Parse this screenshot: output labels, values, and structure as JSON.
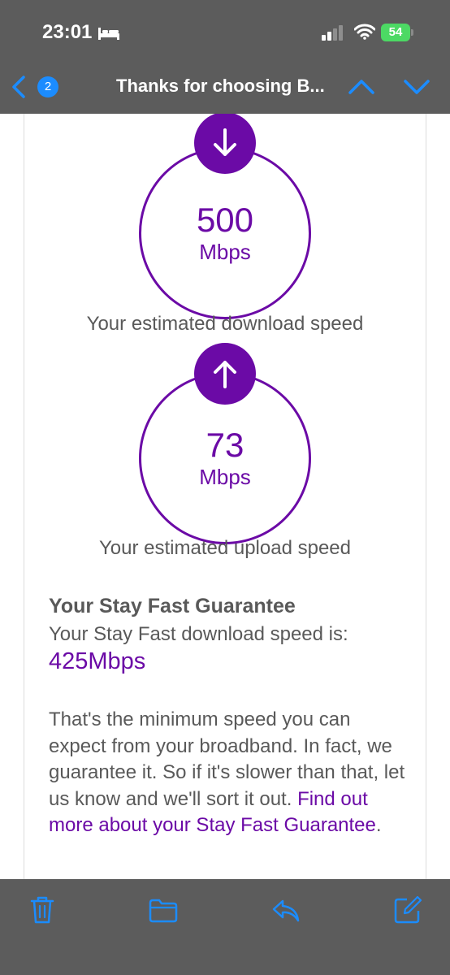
{
  "status_bar": {
    "time": "23:01",
    "battery": "54"
  },
  "nav": {
    "unread_count": "2",
    "title": "Thanks for choosing B..."
  },
  "download": {
    "value": "500",
    "unit": "Mbps",
    "caption": "Your estimated download speed",
    "icon": "arrow-down-icon"
  },
  "upload": {
    "value": "73",
    "unit": "Mbps",
    "caption": "Your estimated upload speed",
    "icon": "arrow-up-icon"
  },
  "guarantee": {
    "title": "Your Stay Fast Guarantee",
    "subtitle": "Your Stay Fast download speed is:",
    "speed": "425Mbps",
    "paragraph": "That's the minimum speed you can expect from your broadband. In fact, we guarantee it. So if it's slower than that, let us know and we'll sort it out.",
    "link_text": "Find out more about your Stay Fast Guarantee",
    "link_suffix": "."
  },
  "toolbar": {
    "icons": [
      "trash-icon",
      "folder-icon",
      "reply-icon",
      "compose-icon"
    ]
  },
  "colors": {
    "brand_purple": "#6b0aa6",
    "ios_blue": "#1b8cff",
    "chrome_gray": "#5c5c5c",
    "text_gray": "#595959",
    "battery_green": "#4cd964"
  }
}
